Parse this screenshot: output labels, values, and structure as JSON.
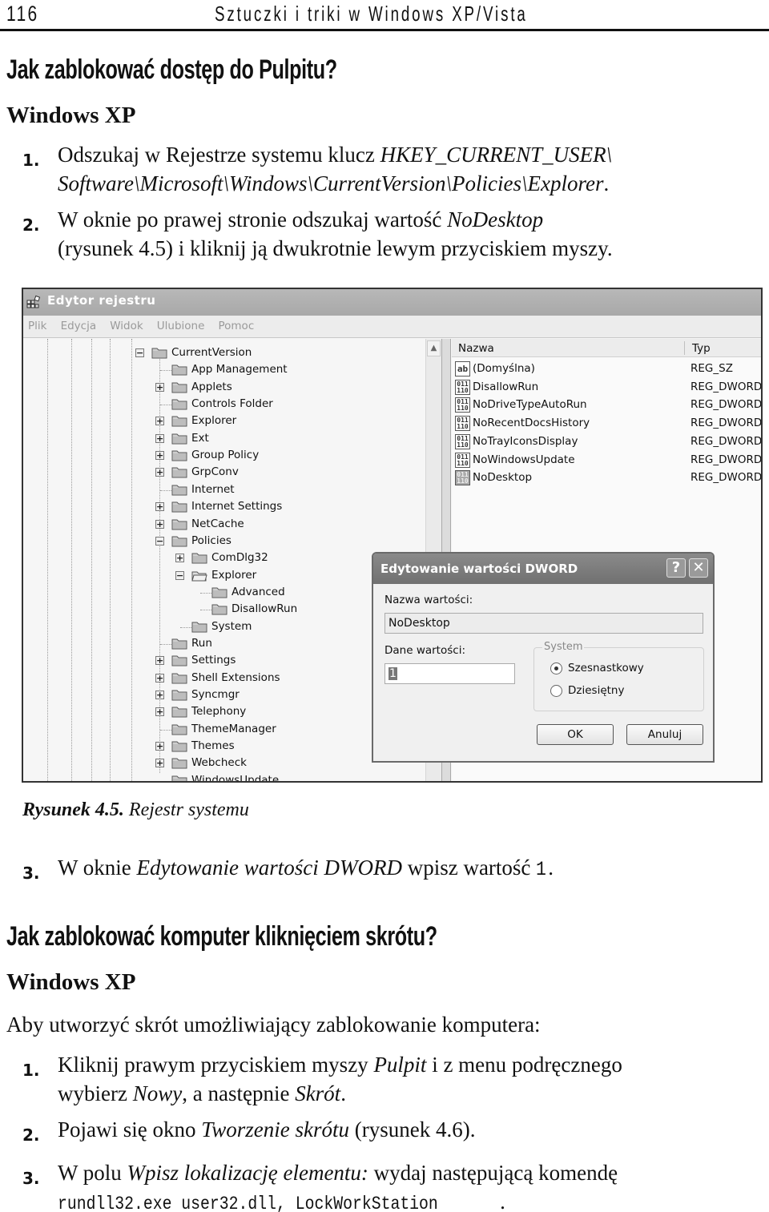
{
  "running_head": {
    "page_number": "116",
    "book_title": "Sztuczki i triki w Windows XP/Vista"
  },
  "section1": {
    "heading": "Jak zablokować dostęp do Pulpitu?",
    "subheading": "Windows XP",
    "steps": [
      {
        "num": "1.",
        "lines": [
          {
            "a": "Odszukaj w Rejestrze systemu klucz ",
            "b": "HKEY_CURRENT_USER\\"
          },
          {
            "b": "Software\\Microsoft\\Windows\\CurrentVersion\\Policies\\Explorer",
            "c": "."
          }
        ]
      },
      {
        "num": "2.",
        "lines": [
          {
            "a": "W oknie po prawej stronie odszukaj wartość ",
            "b": "NoDesktop"
          },
          {
            "a": "(rysunek 4.5) i kliknij ją dwukrotnie lewym przyciskiem myszy."
          }
        ]
      }
    ]
  },
  "figure": {
    "caption_label": "Rysunek 4.5.",
    "caption_text": " Rejestr systemu",
    "registry_window": {
      "title": "Edytor rejestru",
      "menu": [
        "Plik",
        "Edycja",
        "Widok",
        "Ulubione",
        "Pomoc"
      ],
      "tree": [
        {
          "label": "CurrentVersion",
          "level": 0,
          "expander": "minus",
          "open": false
        },
        {
          "label": "App Management",
          "level": 1,
          "expander": "none"
        },
        {
          "label": "Applets",
          "level": 1,
          "expander": "plus"
        },
        {
          "label": "Controls Folder",
          "level": 1,
          "expander": "none"
        },
        {
          "label": "Explorer",
          "level": 1,
          "expander": "plus"
        },
        {
          "label": "Ext",
          "level": 1,
          "expander": "plus"
        },
        {
          "label": "Group Policy",
          "level": 1,
          "expander": "plus"
        },
        {
          "label": "GrpConv",
          "level": 1,
          "expander": "plus"
        },
        {
          "label": "Internet",
          "level": 1,
          "expander": "none"
        },
        {
          "label": "Internet Settings",
          "level": 1,
          "expander": "plus"
        },
        {
          "label": "NetCache",
          "level": 1,
          "expander": "plus"
        },
        {
          "label": "Policies",
          "level": 1,
          "expander": "minus"
        },
        {
          "label": "ComDlg32",
          "level": 2,
          "expander": "plus"
        },
        {
          "label": "Explorer",
          "level": 2,
          "expander": "minus",
          "open": true
        },
        {
          "label": "Advanced",
          "level": 3,
          "expander": "none"
        },
        {
          "label": "DisallowRun",
          "level": 3,
          "expander": "none"
        },
        {
          "label": "System",
          "level": 2,
          "expander": "none"
        },
        {
          "label": "Run",
          "level": 1,
          "expander": "none"
        },
        {
          "label": "Settings",
          "level": 1,
          "expander": "plus"
        },
        {
          "label": "Shell Extensions",
          "level": 1,
          "expander": "plus"
        },
        {
          "label": "Syncmgr",
          "level": 1,
          "expander": "plus"
        },
        {
          "label": "Telephony",
          "level": 1,
          "expander": "plus"
        },
        {
          "label": "ThemeManager",
          "level": 1,
          "expander": "none"
        },
        {
          "label": "Themes",
          "level": 1,
          "expander": "plus"
        },
        {
          "label": "Webcheck",
          "level": 1,
          "expander": "plus"
        },
        {
          "label": "WindowsUpdate",
          "level": 1,
          "expander": "none"
        }
      ],
      "list_columns": {
        "name": "Nazwa",
        "type": "Typ"
      },
      "values": [
        {
          "icon": "string-value-icon",
          "glyph": "ab",
          "name": "(Domyślna)",
          "type": "REG_SZ"
        },
        {
          "icon": "dword-value-icon",
          "glyph": "011\n110",
          "name": "DisallowRun",
          "type": "REG_DWORD"
        },
        {
          "icon": "dword-value-icon",
          "glyph": "011\n110",
          "name": "NoDriveTypeAutoRun",
          "type": "REG_DWORD"
        },
        {
          "icon": "dword-value-icon",
          "glyph": "011\n110",
          "name": "NoRecentDocsHistory",
          "type": "REG_DWORD"
        },
        {
          "icon": "dword-value-icon",
          "glyph": "011\n110",
          "name": "NoTrayIconsDisplay",
          "type": "REG_DWORD"
        },
        {
          "icon": "dword-value-icon",
          "glyph": "011\n110",
          "name": "NoWindowsUpdate",
          "type": "REG_DWORD"
        },
        {
          "icon": "dword-value-icon",
          "glyph": "011\n110",
          "name": "NoDesktop",
          "type": "REG_DWORD",
          "selected": true
        }
      ]
    },
    "dword_dialog": {
      "title": "Edytowanie wartości DWORD",
      "help_glyph": "?",
      "close_glyph": "✕",
      "value_name_label": "Nazwa wartości:",
      "value_name": "NoDesktop",
      "value_data_label": "Dane wartości:",
      "value_data": "1",
      "base_group_label": "System",
      "base_options": [
        {
          "label": "Szesnastkowy",
          "selected": true
        },
        {
          "label": "Dziesiętny",
          "selected": false
        }
      ],
      "ok_label": "OK",
      "cancel_label": "Anuluj"
    }
  },
  "step3": {
    "num": "3.",
    "a": "W oknie ",
    "b": "Edytowanie wartości DWORD",
    "c": " wpisz wartość ",
    "d": "1",
    "e": "."
  },
  "section2": {
    "heading": "Jak zablokować komputer kliknięciem skrótu?",
    "subheading": "Windows XP",
    "intro": "Aby utworzyć skrót umożliwiający zablokowanie komputera:",
    "steps": [
      {
        "num": "1.",
        "l1a": "Kliknij prawym przyciskiem myszy ",
        "l1b": "Pulpit",
        "l1c": " i z menu podręcznego",
        "l2a": "wybierz ",
        "l2b": "Nowy",
        "l2c": ", a następnie ",
        "l2d": "Skrót",
        "l2e": "."
      },
      {
        "num": "2.",
        "a": "Pojawi się okno ",
        "b": "Tworzenie skrótu",
        "c": " (rysunek 4.6)."
      },
      {
        "num": "3.",
        "a": "W polu ",
        "b": "Wpisz lokalizację elementu:",
        "c": " wydaj następującą komendę",
        "cmd": "rundll32.exe user32.dll, LockWorkStation",
        "end": "."
      }
    ]
  }
}
